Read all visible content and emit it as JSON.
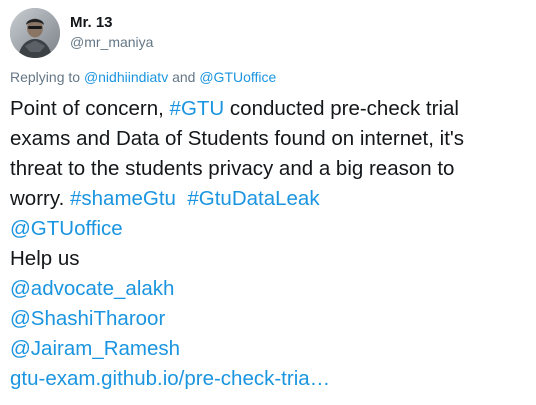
{
  "author": {
    "display_name": "Mr. 13",
    "handle": "@mr_maniya",
    "avatar_icon": "user-avatar"
  },
  "reply_context": {
    "prefix": "Replying to",
    "mention_1": "@nidhiindiatv",
    "connector": "and",
    "mention_2": "@GTUoffice"
  },
  "tweet": {
    "line1_a": "Point of concern, ",
    "line1_hashtag": "#GTU",
    "line1_b": " conducted pre-check trial",
    "line2": "exams and Data of Students found on internet, it's",
    "line3": "threat to the students privacy and a big reason to",
    "line4_a": "worry. ",
    "hashtag_1": "#shameGtu",
    "hashtag_2": "#GtuDataLeak",
    "mention_gtuoffice": "@GTUoffice",
    "help_text": "Help us",
    "mention_advocate": "@advocate_alakh",
    "mention_shashi": "@ShashiTharoor",
    "mention_jairam": "@Jairam_Ramesh",
    "url": "gtu-exam.github.io/pre-check-tria…"
  },
  "colors": {
    "link": "#1b95e0",
    "text": "#14171a",
    "secondary": "#657786"
  }
}
